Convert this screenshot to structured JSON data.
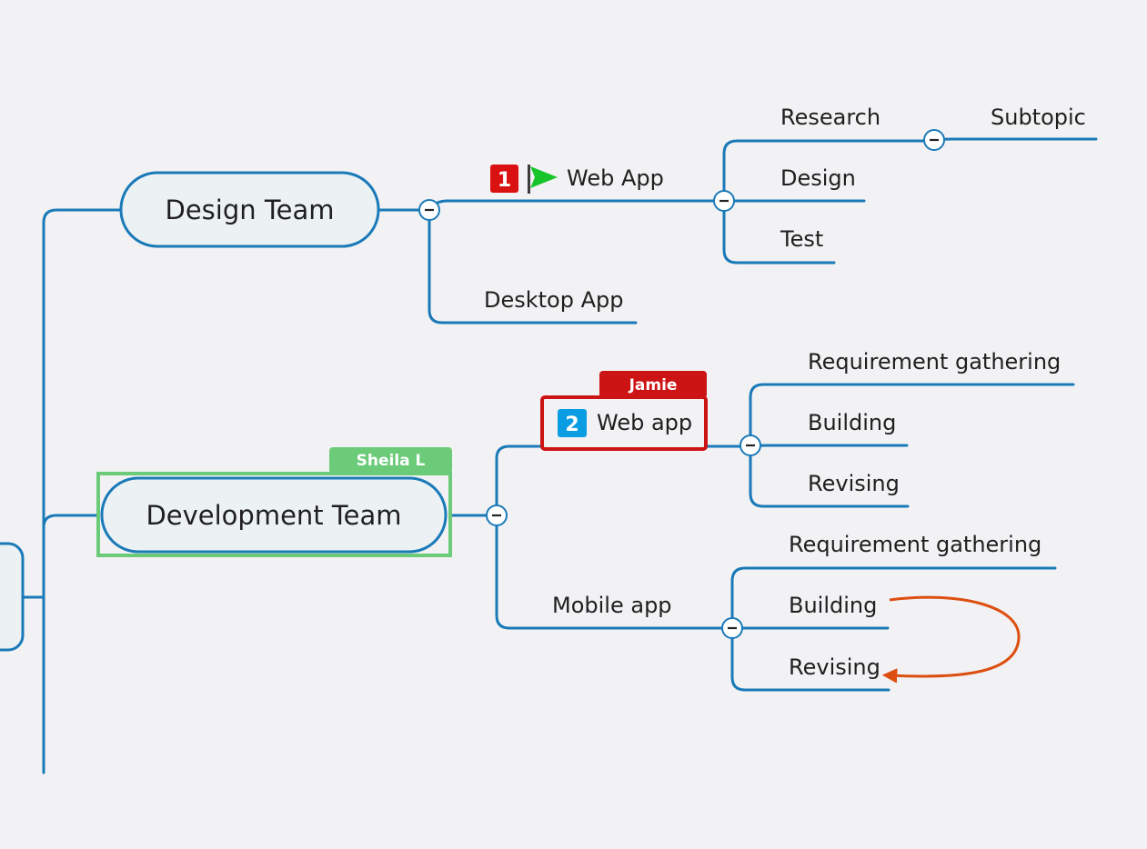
{
  "mindmap": {
    "colors": {
      "branch": "#1a7ab8",
      "node_fill": "#ecf2f4",
      "collapse_fill": "#ffffff",
      "relationship": "#dd4f11",
      "priority_1": "#d91111",
      "priority_2": "#0b9de3",
      "flag_green": "#17c42a",
      "collab_sheila": "#6ccb78",
      "collab_jamie": "#cc1414"
    },
    "design_team": {
      "label": "Design Team",
      "web_app": {
        "label": "Web App",
        "priority_marker": "1",
        "flag_icon": "green-flag-icon",
        "children": [
          {
            "label": "Research",
            "children": [
              {
                "label": "Subtopic"
              }
            ]
          },
          {
            "label": "Design"
          },
          {
            "label": "Test"
          }
        ]
      },
      "desktop_app": {
        "label": "Desktop App"
      }
    },
    "development_team": {
      "label": "Development Team",
      "collaborator": "Sheila L",
      "web_app": {
        "label": "Web app",
        "priority_marker": "2",
        "collaborator": "Jamie",
        "children": [
          {
            "label": "Requirement gathering"
          },
          {
            "label": "Building"
          },
          {
            "label": "Revising"
          }
        ]
      },
      "mobile_app": {
        "label": "Mobile app",
        "children": [
          {
            "label": "Requirement gathering"
          },
          {
            "label": "Building"
          },
          {
            "label": "Revising"
          }
        ]
      }
    },
    "collapse_icon": "minus-circle-icon"
  }
}
